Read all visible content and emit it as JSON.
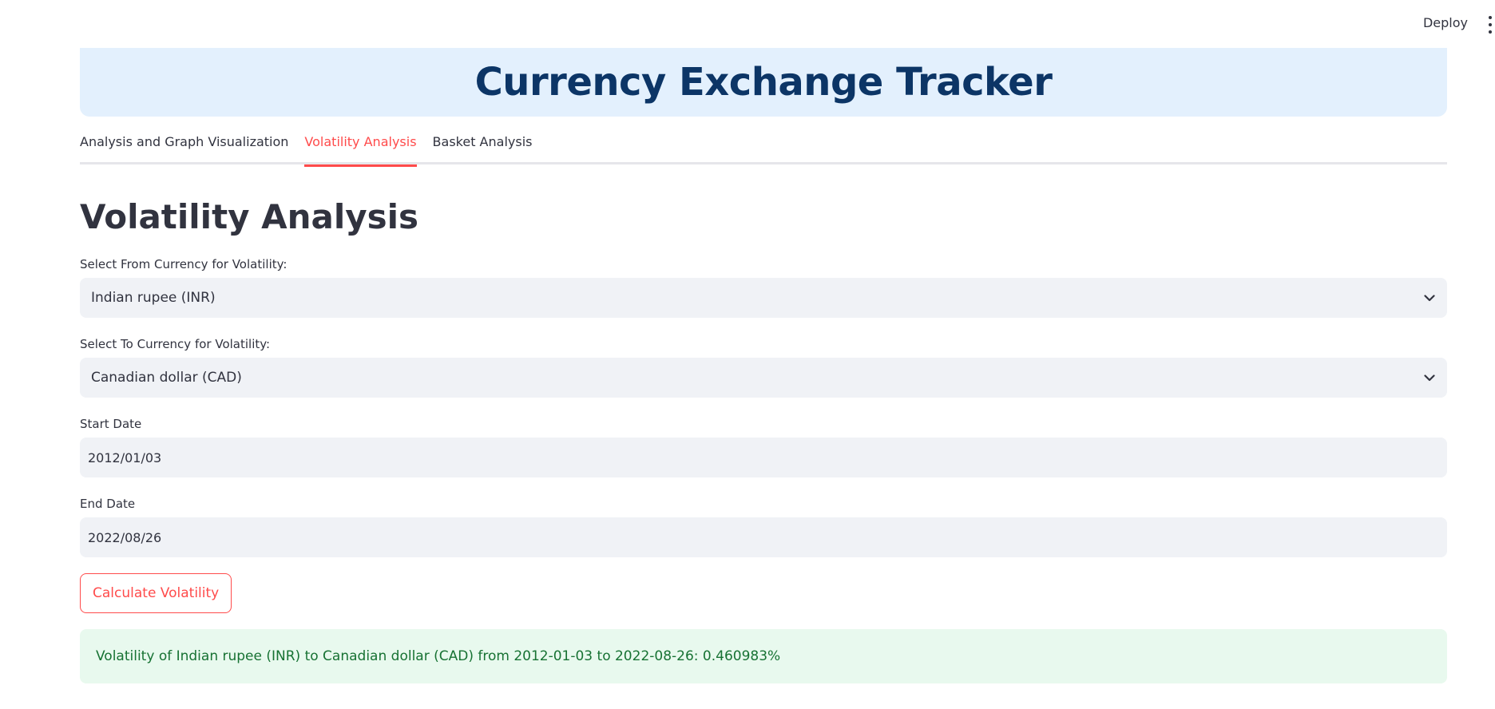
{
  "topbar": {
    "deploy_label": "Deploy",
    "menu_icon": "kebab-menu-icon"
  },
  "banner": {
    "title": "Currency Exchange Tracker",
    "bg_color": "#e3f0fd",
    "title_color": "#0c3566"
  },
  "tabs": [
    {
      "label": "Analysis and Graph Visualization",
      "active": false
    },
    {
      "label": "Volatility Analysis",
      "active": true
    },
    {
      "label": "Basket Analysis",
      "active": false
    }
  ],
  "accent_color": "#ff4b4b",
  "section": {
    "title": "Volatility Analysis"
  },
  "form": {
    "from_currency": {
      "label": "Select From Currency for Volatility:",
      "value": "Indian rupee (INR)"
    },
    "to_currency": {
      "label": "Select To Currency for Volatility:",
      "value": "Canadian dollar (CAD)"
    },
    "start_date": {
      "label": "Start Date",
      "value": "2012/01/03"
    },
    "end_date": {
      "label": "End Date",
      "value": "2022/08/26"
    },
    "calculate_label": "Calculate Volatility"
  },
  "result": {
    "message": "Volatility of Indian rupee (INR) to Canadian dollar (CAD) from 2012-01-03 to 2022-08-26: 0.460983%",
    "bg_color": "#e8f9ee",
    "text_color": "#177233"
  }
}
